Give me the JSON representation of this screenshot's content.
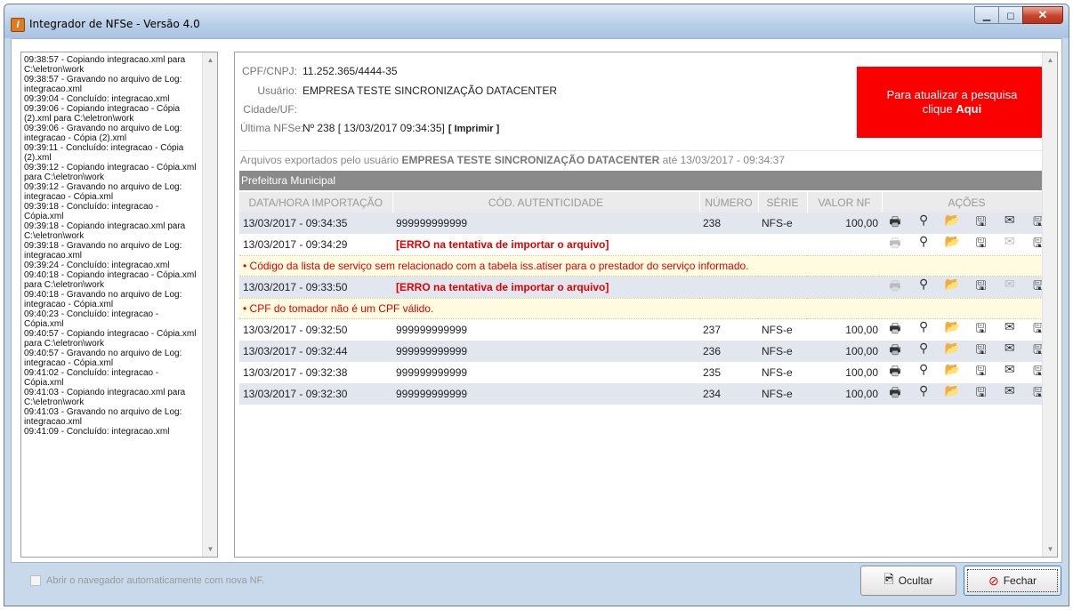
{
  "window": {
    "title": "Integrador de NFSe - Versão 4.0",
    "min_icon": "minimize-icon",
    "max_icon": "maximize-icon",
    "close_icon": "close-icon"
  },
  "log": {
    "lines": [
      "09:38:57 - Copiando integracao.xml para C:\\eletron\\work",
      "09:38:57 - Gravando no arquivo de Log: integracao.xml",
      "09:39:04 - Concluído: integracao.xml",
      "09:39:06 - Copiando integracao - Cópia (2).xml para C:\\eletron\\work",
      "09:39:06 - Gravando no arquivo de Log: integracao - Cópia (2).xml",
      "09:39:11 - Concluído: integracao - Cópia (2).xml",
      "09:39:12 - Copiando integracao - Cópia.xml para C:\\eletron\\work",
      "09:39:12 - Gravando no arquivo de Log: integracao - Cópia.xml",
      "09:39:18 - Concluído: integracao - Cópia.xml",
      "09:39:18 - Copiando integracao.xml para C:\\eletron\\work",
      "09:39:18 - Gravando no arquivo de Log: integracao.xml",
      "09:39:24 - Concluído: integracao.xml",
      "09:40:18 - Copiando integracao - Cópia.xml para C:\\eletron\\work",
      "09:40:18 - Gravando no arquivo de Log: integracao - Cópia.xml",
      "09:40:23 - Concluído: integracao - Cópia.xml",
      "09:40:57 - Copiando integracao - Cópia.xml para C:\\eletron\\work",
      "09:40:57 - Gravando no arquivo de Log: integracao - Cópia.xml",
      "09:41:02 - Concluído: integracao - Cópia.xml",
      "09:41:03 - Copiando integracao.xml para C:\\eletron\\work",
      "09:41:03 - Gravando no arquivo de Log: integracao.xml",
      "09:41:09 - Concluído: integracao.xml"
    ]
  },
  "info": {
    "cpf_label": "CPF/CNPJ:",
    "cpf_value": "11.252.365/4444-35",
    "user_label": "Usuário:",
    "user_value": "EMPRESA TESTE SINCRONIZAÇÃO DATACENTER",
    "city_label": "Cidade/UF:",
    "city_value": "",
    "last_label": "Última NFSe:",
    "last_value": "Nº 238  [ 13/03/2017 09:34:35]",
    "print_link": "[ Imprimir ]"
  },
  "refresh": {
    "line1": "Para atualizar a pesquisa",
    "line2_prefix": "clique ",
    "line2_link": "Aqui",
    "color": "#fb0000"
  },
  "export_line": {
    "prefix": "Arquivos exportados pelo usuário ",
    "user": "EMPRESA TESTE SINCRONIZAÇÃO DATACENTER",
    "suffix": " até 13/03/2017 - 09:34:37"
  },
  "section_title": "Prefeitura Municipal",
  "table": {
    "headers": [
      "DATA/HORA IMPORTAÇÃO",
      "CÓD. AUTENTICIDADE",
      "NÚMERO",
      "SÉRIE",
      "VALOR NF",
      "AÇÕES"
    ],
    "rows": [
      {
        "kind": "ok",
        "date": "13/03/2017 - 09:34:35",
        "code": "999999999999",
        "number": "238",
        "serie": "NFS-e",
        "value": "100,00",
        "style": "a"
      },
      {
        "kind": "error",
        "date": "13/03/2017 - 09:34:29",
        "code": "[ERRO na tentativa de importar o arquivo]",
        "style": "b",
        "message": "Código da lista de serviço sem relacionado com a tabela iss.atiser para o prestador do serviço informado."
      },
      {
        "kind": "error",
        "date": "13/03/2017 - 09:33:50",
        "code": "[ERRO na tentativa de importar o arquivo]",
        "style": "a",
        "message": "CPF do tomador não é um CPF válido."
      },
      {
        "kind": "ok",
        "date": "13/03/2017 - 09:32:50",
        "code": "999999999999",
        "number": "237",
        "serie": "NFS-e",
        "value": "100,00",
        "style": "b"
      },
      {
        "kind": "ok",
        "date": "13/03/2017 - 09:32:44",
        "code": "999999999999",
        "number": "236",
        "serie": "NFS-e",
        "value": "100,00",
        "style": "a"
      },
      {
        "kind": "ok",
        "date": "13/03/2017 - 09:32:38",
        "code": "999999999999",
        "number": "235",
        "serie": "NFS-e",
        "value": "100,00",
        "style": "b"
      },
      {
        "kind": "ok",
        "date": "13/03/2017 - 09:32:30",
        "code": "999999999999",
        "number": "234",
        "serie": "NFS-e",
        "value": "100,00",
        "style": "a"
      }
    ],
    "action_icons": [
      "print-icon",
      "search-icon",
      "open-folder-icon",
      "export-icon",
      "email-icon",
      "export-xml-icon"
    ]
  },
  "footer": {
    "checkbox_label": "Abrir o navegador automaticamente com nova NF.",
    "hide_button": "Ocultar",
    "close_button": "Fechar"
  }
}
